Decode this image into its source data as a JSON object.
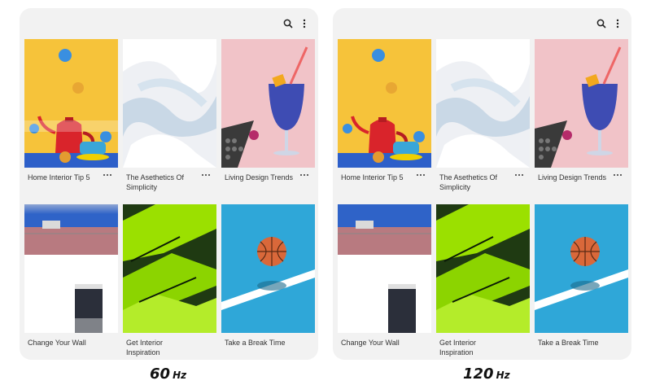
{
  "left_panel": {
    "refresh_rate": "60",
    "unit": "Hz",
    "cards": [
      {
        "title": "Home Interior Tip 5"
      },
      {
        "title": "The Asethetics Of Simplicity"
      },
      {
        "title": "Living Design Trends"
      },
      {
        "title": "Change Your Wall"
      },
      {
        "title": "Get Interior Inspiration"
      },
      {
        "title": "Take a Break Time"
      }
    ]
  },
  "right_panel": {
    "refresh_rate": "120",
    "unit": "Hz",
    "cards": [
      {
        "title": "Home Interior Tip 5"
      },
      {
        "title": "The Asethetics Of Simplicity"
      },
      {
        "title": "Living Design Trends"
      },
      {
        "title": "Change Your Wall"
      },
      {
        "title": "Get Interior Inspiration"
      },
      {
        "title": "Take a Break Time"
      }
    ]
  },
  "icons": {
    "search": "search-icon",
    "more": "more-vertical-icon",
    "card_more": "more-horizontal-icon"
  },
  "colors": {
    "panel_bg": "#f2f2f2",
    "yellow": "#f6c33a",
    "pink": "#f1c3c8",
    "blue_sky": "#2f63c8",
    "lime": "#8cd400",
    "court_blue": "#2fa7d8"
  }
}
